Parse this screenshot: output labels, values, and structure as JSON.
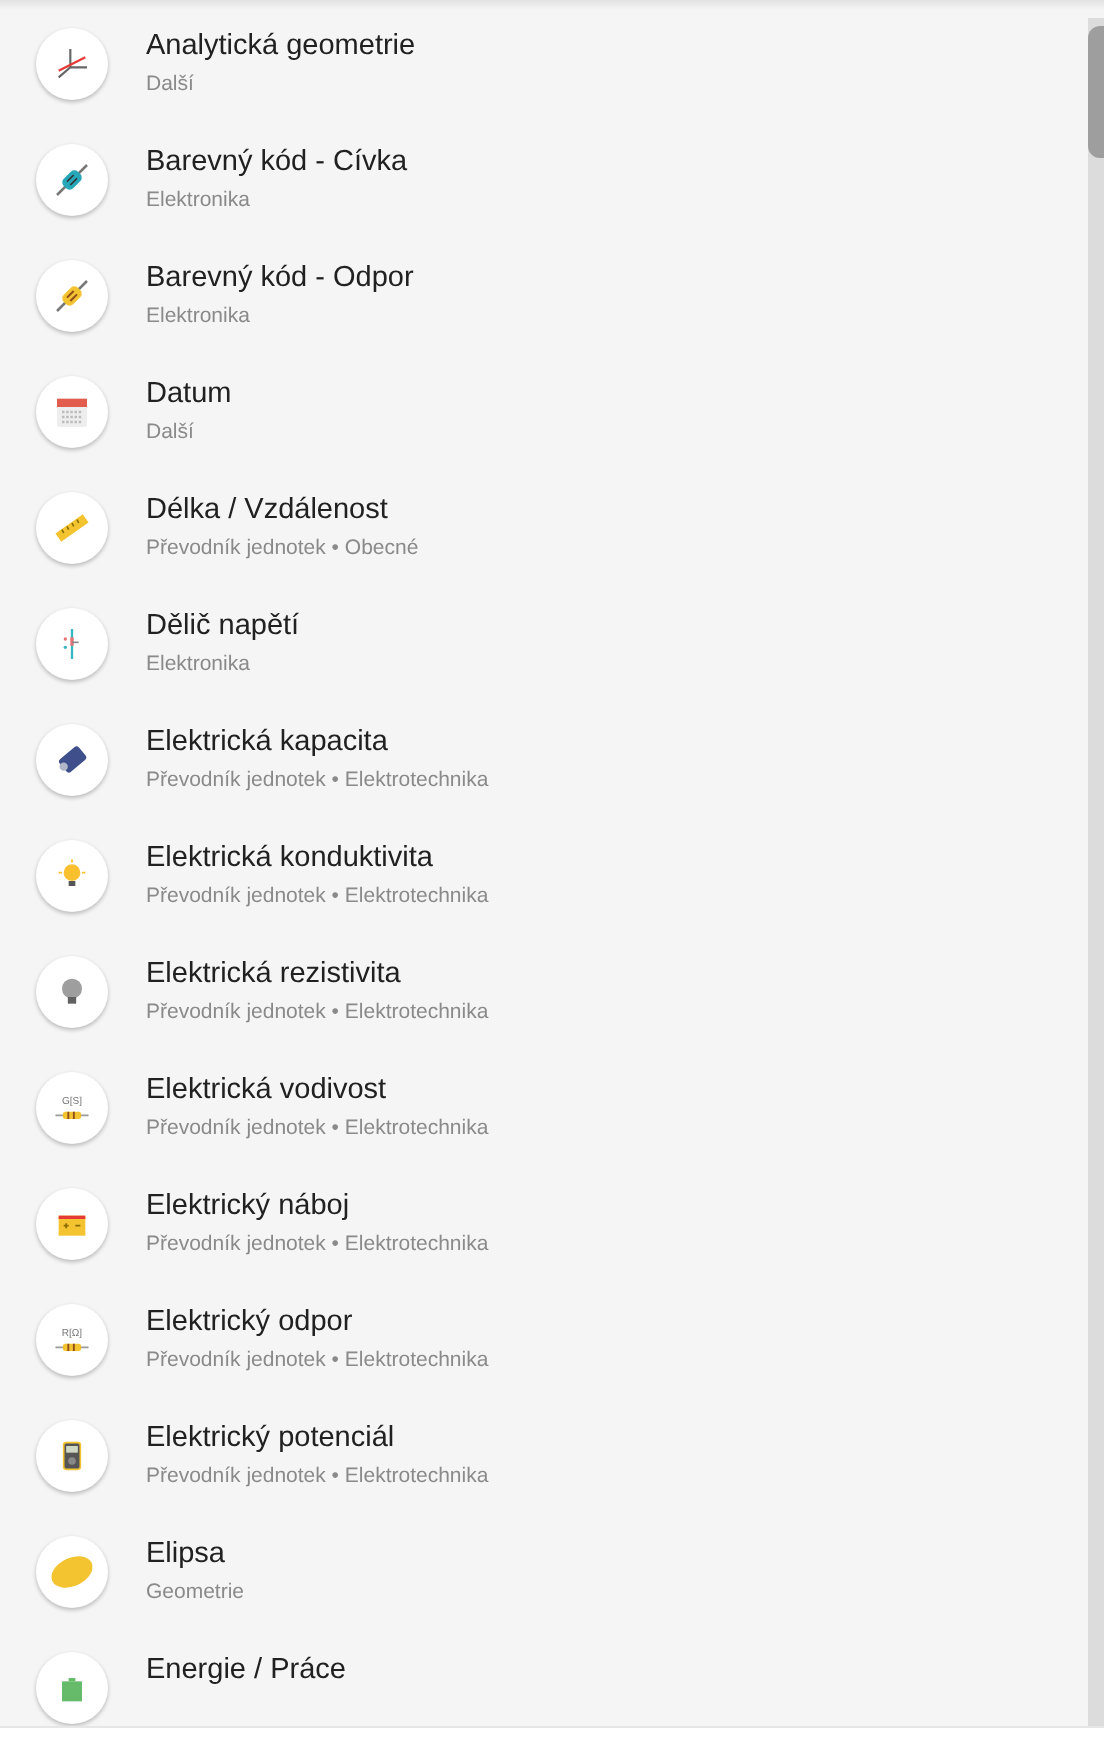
{
  "items": [
    {
      "title": "Analytická geometrie",
      "subtitle": "Další"
    },
    {
      "title": "Barevný kód - Cívka",
      "subtitle": "Elektronika"
    },
    {
      "title": "Barevný kód - Odpor",
      "subtitle": "Elektronika"
    },
    {
      "title": "Datum",
      "subtitle": "Další"
    },
    {
      "title": "Délka / Vzdálenost",
      "subtitle": "Převodník jednotek • Obecné"
    },
    {
      "title": "Dělič napětí",
      "subtitle": "Elektronika"
    },
    {
      "title": "Elektrická kapacita",
      "subtitle": "Převodník jednotek • Elektrotechnika"
    },
    {
      "title": "Elektrická konduktivita",
      "subtitle": "Převodník jednotek • Elektrotechnika"
    },
    {
      "title": "Elektrická rezistivita",
      "subtitle": "Převodník jednotek • Elektrotechnika"
    },
    {
      "title": "Elektrická vodivost",
      "subtitle": "Převodník jednotek • Elektrotechnika",
      "icon_label": "G[S]"
    },
    {
      "title": "Elektrický náboj",
      "subtitle": "Převodník jednotek • Elektrotechnika"
    },
    {
      "title": "Elektrický odpor",
      "subtitle": "Převodník jednotek • Elektrotechnika",
      "icon_label": "R[Ω]"
    },
    {
      "title": "Elektrický potenciál",
      "subtitle": "Převodník jednotek • Elektrotechnika"
    },
    {
      "title": "Elipsa",
      "subtitle": "Geometrie"
    },
    {
      "title": "Energie / Práce"
    }
  ]
}
